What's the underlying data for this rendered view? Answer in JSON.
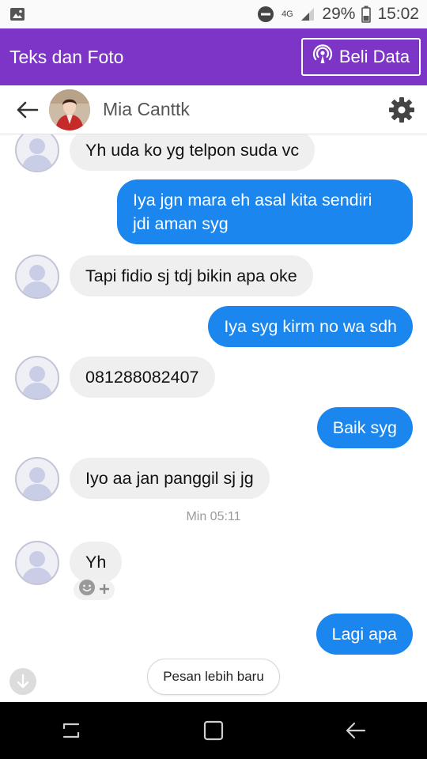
{
  "status_bar": {
    "network_type": "4G",
    "battery_percent": "29%",
    "time": "15:02",
    "icons": [
      "image-icon",
      "do-not-disturb-icon",
      "signal-icon",
      "battery-icon"
    ]
  },
  "app_bar": {
    "title": "Teks dan Foto",
    "buy_data_label": "Beli Data",
    "background": "#7c35c7"
  },
  "chat_header": {
    "contact_name": "Mia Canttk"
  },
  "messages": [
    {
      "side": "in",
      "text": "Yh uda ko yg telpon suda vc"
    },
    {
      "side": "out",
      "lines": [
        "Iya jgn mara eh asal kita sendiri",
        "jdi aman syg"
      ]
    },
    {
      "side": "in",
      "text": "Tapi fidio sj tdj bikin apa oke"
    },
    {
      "side": "out",
      "text": "Iya syg kirm no wa sdh"
    },
    {
      "side": "in",
      "text": "081288082407"
    },
    {
      "side": "out",
      "text": "Baik syg"
    },
    {
      "side": "in",
      "text": "Iyo aa jan panggil sj jg"
    },
    {
      "side": "in",
      "text": "Yh"
    },
    {
      "side": "out",
      "text": "Lagi apa"
    }
  ],
  "timestamp": "Min 05:11",
  "newer_messages_label": "Pesan lebih baru",
  "colors": {
    "incoming_bubble": "#efefef",
    "outgoing_bubble": "#1b86ee",
    "accent": "#7c35c7"
  }
}
